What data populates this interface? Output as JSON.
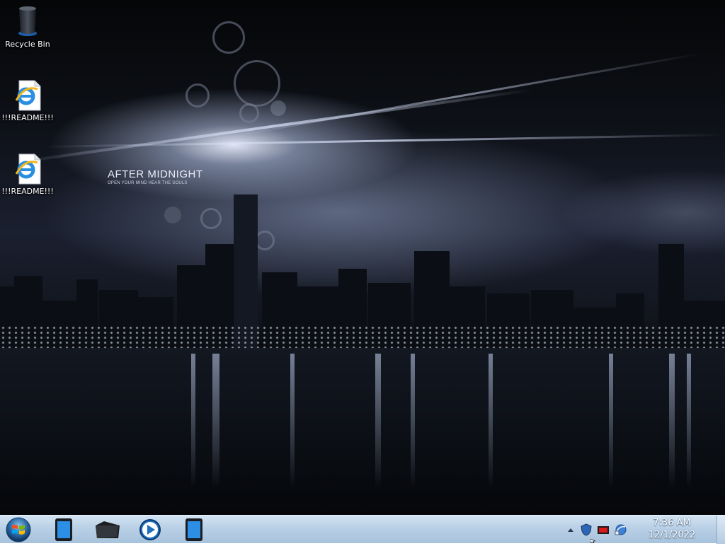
{
  "wallpaper": {
    "title": "AFTER MIDNIGHT",
    "subtitle": "OPEN YOUR MIND HEAR THE SOULS"
  },
  "desktop_icons": [
    {
      "label": "Recycle Bin",
      "icon": "recycle-bin-icon"
    },
    {
      "label": "!!!README!!!",
      "icon": "internet-explorer-file-icon"
    },
    {
      "label": "!!!README!!!",
      "icon": "internet-explorer-file-icon"
    }
  ],
  "taskbar": {
    "start_icon": "windows-start-orb-icon",
    "pinned": [
      {
        "icon": "blue-device-icon"
      },
      {
        "icon": "black-folder-icon"
      },
      {
        "icon": "media-player-icon"
      },
      {
        "icon": "blue-device-icon"
      }
    ],
    "tray": {
      "icons": [
        "show-hidden-icons-arrow-icon",
        "security-shield-icon",
        "red-display-icon",
        "network-globe-icon"
      ]
    },
    "clock": {
      "time": "7:36 AM",
      "date": "12/1/2022"
    }
  },
  "colors": {
    "taskbar_top": "#d2e3f2",
    "taskbar_bottom": "#a7c2dc",
    "sky_dark": "#050608",
    "glow": "#ebf0ff"
  }
}
